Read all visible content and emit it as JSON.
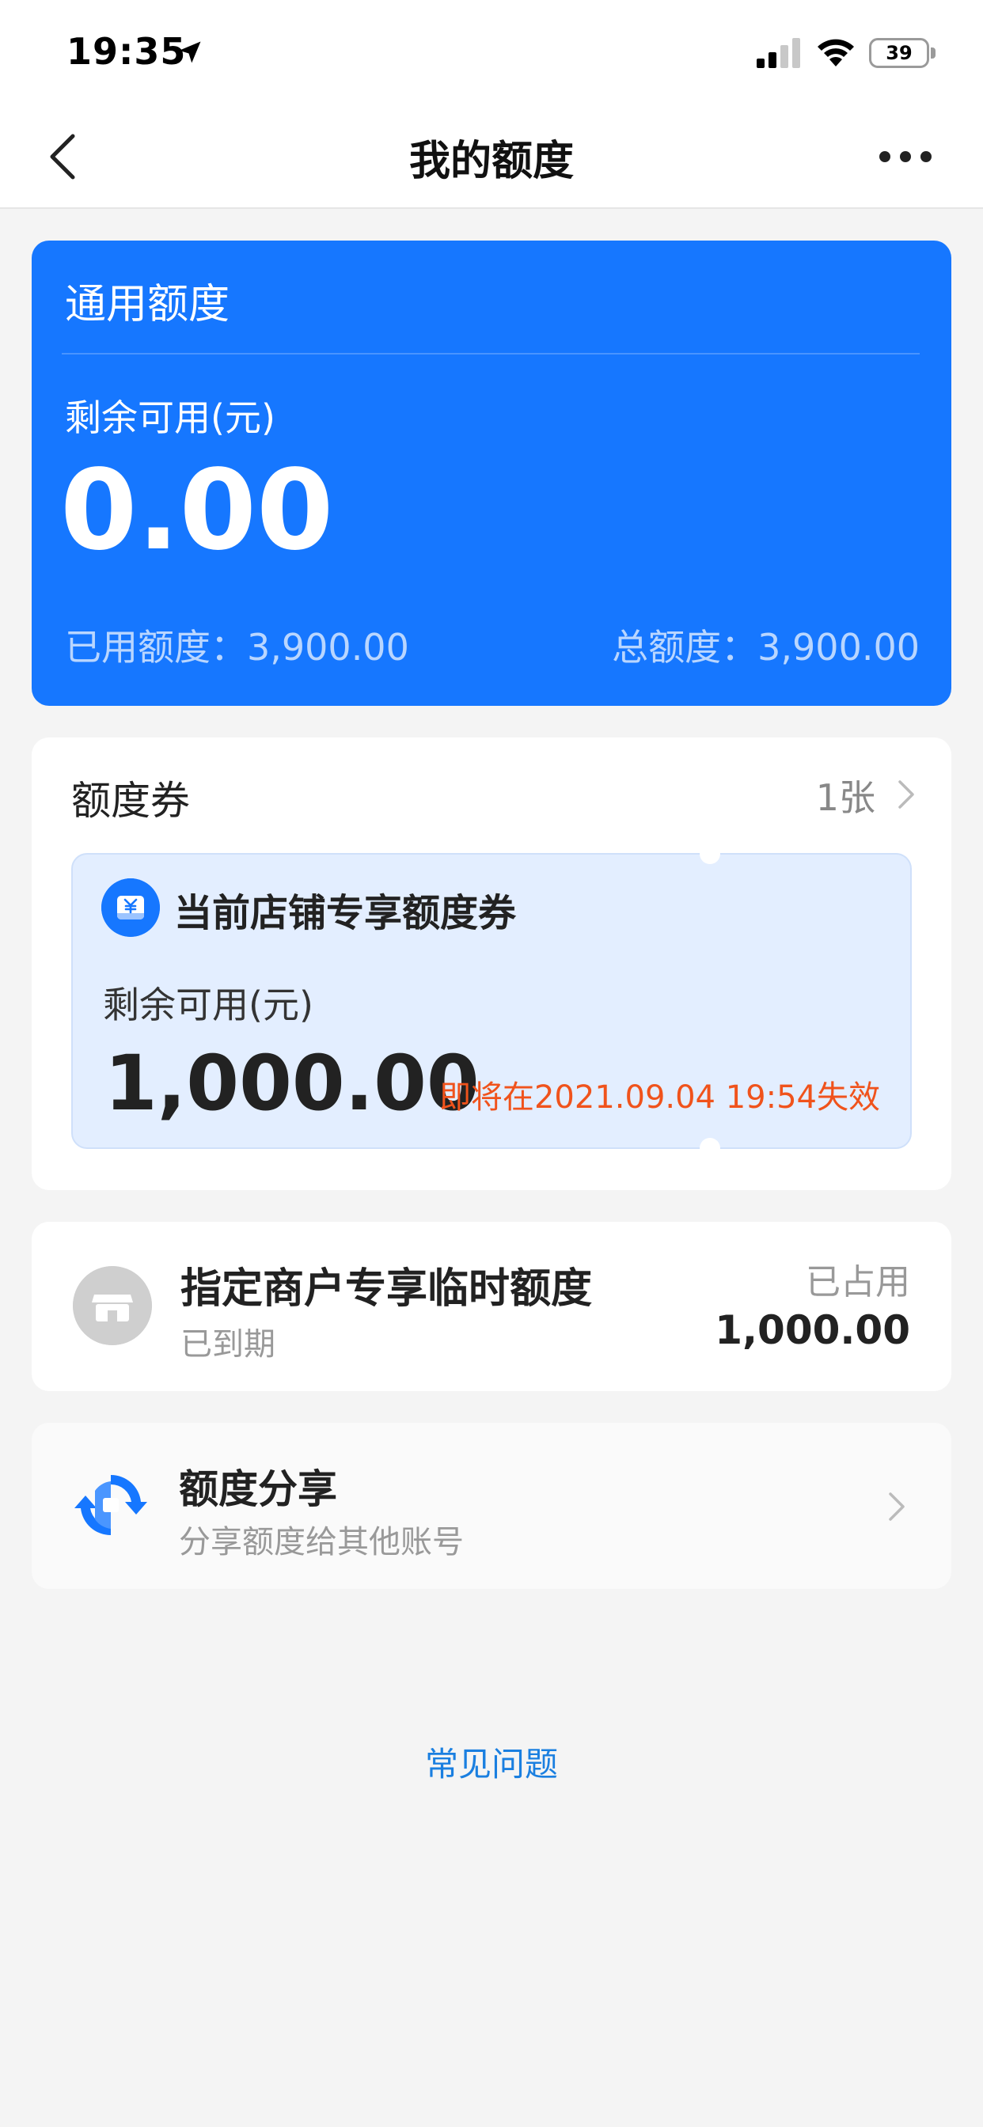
{
  "status_bar": {
    "time": "19:35",
    "battery": "39",
    "icons": [
      "location-arrow-icon",
      "signal-icon",
      "wifi-icon",
      "battery-icon"
    ]
  },
  "nav": {
    "title": "我的额度",
    "back_icon": "chevron-left-icon",
    "more_icon": "more-dots-icon"
  },
  "quota_card": {
    "title": "通用额度",
    "available_label": "剩余可用(元)",
    "available_amount": "0.00",
    "used": "已用额度：3,900.00",
    "total": "总额度：3,900.00",
    "color": "#1677ff"
  },
  "coupons": {
    "title": "额度券",
    "count": "1张",
    "items": [
      {
        "name": "当前店铺专享额度券",
        "icon": "yuan-coupon-icon",
        "available_label": "剩余可用(元)",
        "amount": "1,000.00",
        "expire": "即将在2021.09.04 19:54失效",
        "expire_color": "#f0531c"
      }
    ]
  },
  "merchant_quota": {
    "icon": "store-icon",
    "title": "指定商户专享临时额度",
    "status": "已到期",
    "right_label": "已占用",
    "right_value": "1,000.00"
  },
  "share": {
    "icon": "share-exchange-icon",
    "title": "额度分享",
    "subtitle": "分享额度给其他账号"
  },
  "faq": {
    "label": "常见问题",
    "color": "#1a7fe0"
  }
}
